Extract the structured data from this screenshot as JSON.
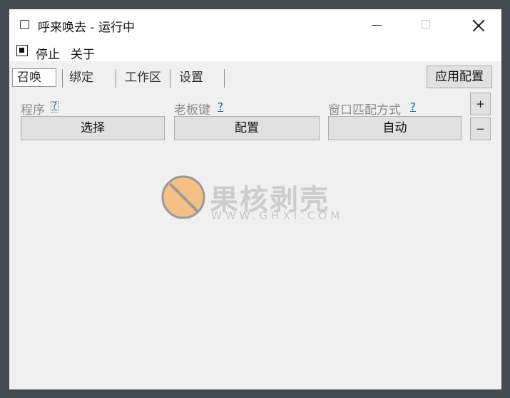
{
  "window": {
    "title": "呼来唤去 - 运行中"
  },
  "menubar": {
    "stop_label": "停止",
    "about_label": "关于"
  },
  "tabs": [
    {
      "label": "召唤",
      "active": true
    },
    {
      "label": "绑定",
      "active": false
    },
    {
      "label": "工作区",
      "active": false
    },
    {
      "label": "设置",
      "active": false
    }
  ],
  "toolbar": {
    "apply_label": "应用配置"
  },
  "fields": {
    "program": {
      "label": "程序",
      "help": "?",
      "button": "选择"
    },
    "boss_key": {
      "label": "老板键",
      "help": "?",
      "button": "配置"
    },
    "window_match": {
      "label": "窗口匹配方式",
      "help": "?",
      "button": "自动"
    }
  },
  "side_buttons": {
    "plus": "+",
    "minus": "−"
  },
  "watermark": {
    "brand": "果核剥壳",
    "url": "WWW.GHXI.COM",
    "logo_color": "#f5bf86"
  }
}
